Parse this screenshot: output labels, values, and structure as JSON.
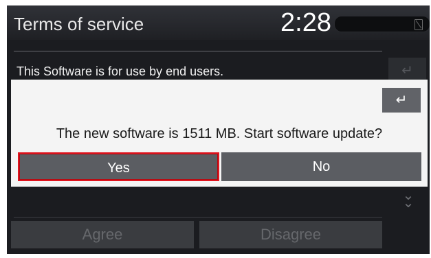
{
  "header": {
    "title": "Terms of service",
    "clock": "2:28"
  },
  "terms": {
    "text": "This Software is for use by end users.",
    "agree_label": "Agree",
    "disagree_label": "Disagree"
  },
  "dialog": {
    "message": "The new software is 1511 MB. Start software update?",
    "yes_label": "Yes",
    "no_label": "No"
  },
  "colors": {
    "background": "#1b1c20",
    "dialog": "#f4f4f4",
    "button": "#5b5d62",
    "focus": "#e0151f"
  },
  "icons": [
    "back-arrow-icon",
    "scroll-down-icon",
    "no-sim-icon"
  ]
}
